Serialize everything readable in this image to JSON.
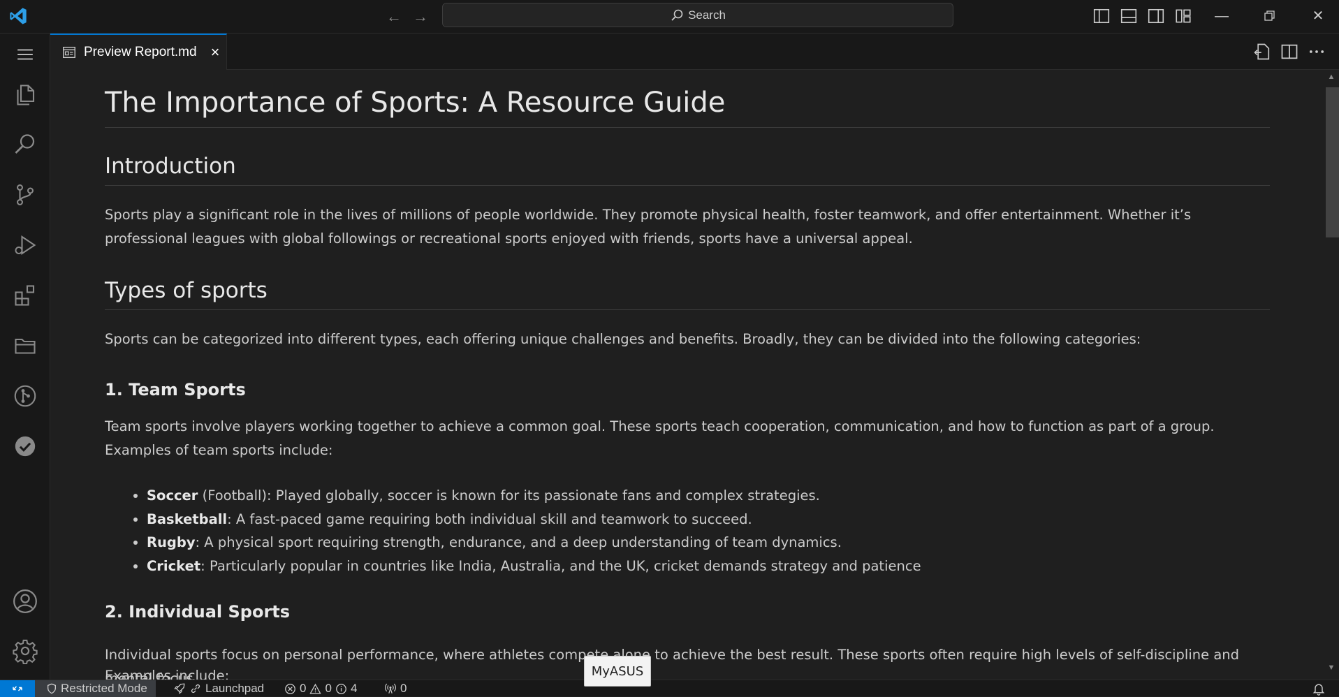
{
  "titlebar": {
    "search_placeholder": "Search"
  },
  "tab": {
    "label": "Preview Report.md",
    "close": "×"
  },
  "document": {
    "title": "The Importance of Sports: A Resource Guide",
    "sections": [
      {
        "heading": "Introduction",
        "paragraph": "Sports play a significant role in the lives of millions of people worldwide. They promote physical health, foster teamwork, and offer entertainment. Whether it’s professional leagues with global followings or recreational sports enjoyed with friends, sports have a universal appeal."
      },
      {
        "heading": "Types of sports",
        "paragraph": "Sports can be categorized into different types, each offering unique challenges and benefits. Broadly, they can be divided into the following categories:"
      }
    ],
    "team_sports": {
      "heading": "1. Team Sports",
      "paragraph": "Team sports involve players working together to achieve a common goal. These sports teach cooperation, communication, and how to function as part of a group. Examples of team sports include:",
      "items": [
        {
          "term": "Soccer",
          "text": " (Football): Played globally, soccer is known for its passionate fans and complex strategies."
        },
        {
          "term": "Basketball",
          "text": ": A fast-paced game requiring both individual skill and teamwork to succeed."
        },
        {
          "term": "Rugby",
          "text": ": A physical sport requiring strength, endurance, and a deep understanding of team dynamics."
        },
        {
          "term": "Cricket",
          "text": ": Particularly popular in countries like India, Australia, and the UK, cricket demands strategy and patience"
        }
      ]
    },
    "individual_sports": {
      "heading": "2. Individual Sports",
      "paragraph": "Individual sports focus on personal performance, where athletes compete alone to achieve the best result. These sports often require high levels of self-discipline and mental focus.",
      "partial_line": "Examples include:"
    }
  },
  "statusbar": {
    "restricted_mode": "Restricted Mode",
    "launchpad": "Launchpad",
    "errors": "0",
    "warnings": "0",
    "infos": "4",
    "ports": "0"
  },
  "tooltip": "MyASUS",
  "colors": {
    "accent": "#0078d4",
    "background": "#1f1f1f",
    "chrome": "#181818"
  }
}
